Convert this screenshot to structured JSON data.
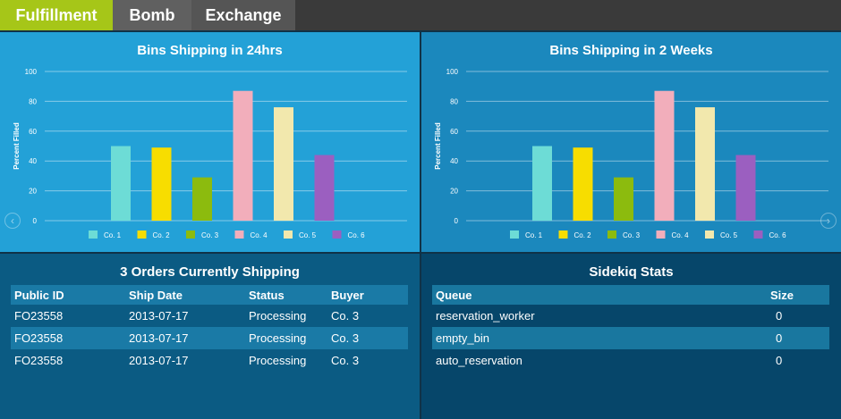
{
  "nav": {
    "tabs": [
      {
        "label": "Fulfillment",
        "active": true
      },
      {
        "label": "Bomb",
        "active": false
      },
      {
        "label": "Exchange",
        "active": false
      }
    ]
  },
  "colors": {
    "accent": "#a6c618",
    "series": [
      "#6ddcd6",
      "#f7dd00",
      "#8cbb0e",
      "#f2aebb",
      "#f2e8ad",
      "#9b5fc0"
    ]
  },
  "charts": {
    "left_title": "Bins Shipping in 24hrs",
    "right_title": "Bins Shipping in 2 Weeks"
  },
  "icons": {
    "prev": "chevron-left-icon",
    "next": "chevron-right-icon"
  },
  "chart_data": [
    {
      "type": "bar",
      "title": "Bins Shipping in 24hrs",
      "ylabel": "Percent Filled",
      "xlabel": "",
      "categories": [
        "Co. 1",
        "Co. 2",
        "Co. 3",
        "Co. 4",
        "Co. 5",
        "Co. 6"
      ],
      "values": [
        50,
        49,
        29,
        87,
        76,
        44
      ],
      "ylim": [
        0,
        100
      ],
      "yticks": [
        0,
        20,
        40,
        60,
        80,
        100
      ],
      "grid": true,
      "legend": "bottom"
    },
    {
      "type": "bar",
      "title": "Bins Shipping in 2 Weeks",
      "ylabel": "Percent Filled",
      "xlabel": "",
      "categories": [
        "Co. 1",
        "Co. 2",
        "Co. 3",
        "Co. 4",
        "Co. 5",
        "Co. 6"
      ],
      "values": [
        50,
        49,
        29,
        87,
        76,
        44
      ],
      "ylim": [
        0,
        100
      ],
      "yticks": [
        0,
        20,
        40,
        60,
        80,
        100
      ],
      "grid": true,
      "legend": "bottom"
    }
  ],
  "orders": {
    "title": "3 Orders Currently Shipping",
    "columns": [
      "Public ID",
      "Ship Date",
      "Status",
      "Buyer"
    ],
    "rows": [
      [
        "FO23558",
        "2013-07-17",
        "Processing",
        "Co. 3"
      ],
      [
        "FO23558",
        "2013-07-17",
        "Processing",
        "Co. 3"
      ],
      [
        "FO23558",
        "2013-07-17",
        "Processing",
        "Co. 3"
      ]
    ]
  },
  "sidekiq": {
    "title": "Sidekiq Stats",
    "columns": [
      "Queue",
      "Size"
    ],
    "rows": [
      [
        "reservation_worker",
        "0"
      ],
      [
        "empty_bin",
        "0"
      ],
      [
        "auto_reservation",
        "0"
      ]
    ]
  }
}
